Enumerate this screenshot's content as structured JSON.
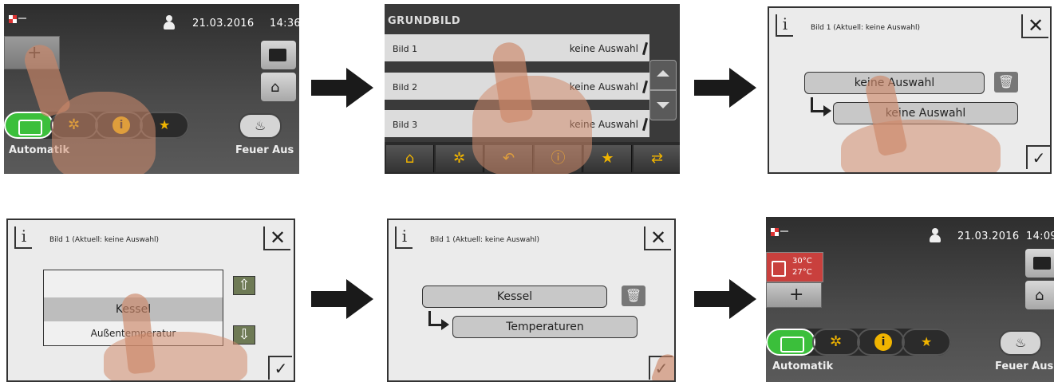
{
  "panel1": {
    "date": "21.03.2016",
    "time": "14:36",
    "add_label": "+",
    "mode_label": "Automatik",
    "fire_label": "Feuer Aus"
  },
  "panel2": {
    "header": "GRUNDBILD",
    "rows": [
      {
        "label": "Bild 1",
        "value": "keine Auswahl"
      },
      {
        "label": "Bild 2",
        "value": "keine Auswahl"
      },
      {
        "label": "Bild 3",
        "value": "keine Auswahl"
      }
    ]
  },
  "panel3": {
    "title": "Bild 1 (Aktuell: keine Auswahl)",
    "field_main": "keine Auswahl",
    "field_sub": "keine Auswahl",
    "close": "✕",
    "ok": "✓"
  },
  "panel4": {
    "title": "Bild 1 (Aktuell: keine Auswahl)",
    "list_selected": "Kessel",
    "list_next": "Außentemperatur",
    "close": "✕",
    "ok": "✓"
  },
  "panel5": {
    "title": "Bild 1 (Aktuell: keine Auswahl)",
    "field_main": "Kessel",
    "field_sub": "Temperaturen",
    "close": "✕",
    "ok": "✓"
  },
  "panel6": {
    "date": "21.03.2016",
    "time": "14:09",
    "temp1": "30°C",
    "temp2": "27°C",
    "add_label": "+",
    "mode_label": "Automatik",
    "fire_label": "Feuer Aus"
  },
  "colors": {
    "arrow": "#1a1a1a",
    "active_mode": "#3bbf3b",
    "mode_icon": "#f0b400",
    "tile_red": "#c9403d",
    "arrow_button": "#6e7a55"
  },
  "icons": [
    "usb-status-icon",
    "user-icon",
    "suitcase-icon",
    "chimney-sweep-icon",
    "boiler-icon",
    "gears-icon",
    "info-icon",
    "favorites-icon",
    "fire-icon",
    "home-icon",
    "back-icon",
    "scroll-up-icon",
    "scroll-down-icon",
    "trash-icon",
    "arrow-up-icon",
    "arrow-down-icon",
    "check-icon",
    "close-icon"
  ]
}
